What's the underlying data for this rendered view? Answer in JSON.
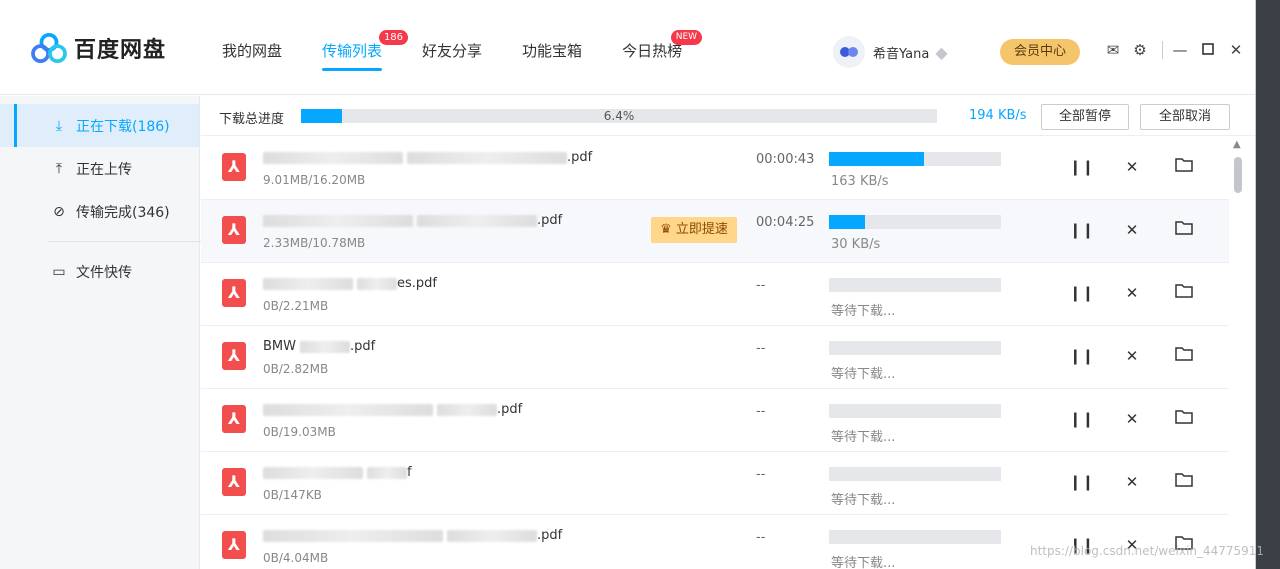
{
  "app": {
    "name": "百度网盘"
  },
  "nav": {
    "tabs": [
      {
        "label": "我的网盘"
      },
      {
        "label": "传输列表",
        "badge": "186"
      },
      {
        "label": "好友分享"
      },
      {
        "label": "功能宝箱"
      },
      {
        "label": "今日热榜",
        "badge": "NEW"
      }
    ]
  },
  "user": {
    "name": "希音Yana",
    "vip_label": "会员中心"
  },
  "sidebar": {
    "items": [
      {
        "label": "正在下载(186)",
        "icon": "download-icon"
      },
      {
        "label": "正在上传",
        "icon": "upload-icon"
      },
      {
        "label": "传输完成(346)",
        "icon": "check-circle-icon"
      },
      {
        "label": "文件快传",
        "icon": "monitor-icon"
      }
    ]
  },
  "progress": {
    "label": "下载总进度",
    "percent_text": "6.4%",
    "percent": 6.4,
    "speed": "194 KB/s",
    "pause_all": "全部暂停",
    "cancel_all": "全部取消"
  },
  "downloads": [
    {
      "name_a": "",
      "name_b": ".pdf",
      "size": "9.01MB/16.20MB",
      "time": "00:00:43",
      "progress": 0.55,
      "speed": "163 KB/s"
    },
    {
      "name_a": "",
      "name_b": ".pdf",
      "size": "2.33MB/10.78MB",
      "time": "00:04:25",
      "progress": 0.21,
      "speed": "30 KB/s",
      "boost": "立即提速"
    },
    {
      "name_a": "",
      "name_b": "es.pdf",
      "size": "0B/2.21MB",
      "time": "--",
      "progress": 0,
      "speed": "等待下载..."
    },
    {
      "name_a": "BMW",
      "name_b": ".pdf",
      "size": "0B/2.82MB",
      "time": "--",
      "progress": 0,
      "speed": "等待下载..."
    },
    {
      "name_a": "",
      "name_b": ".pdf",
      "size": "0B/19.03MB",
      "time": "--",
      "progress": 0,
      "speed": "等待下载..."
    },
    {
      "name_a": "",
      "name_b": "f",
      "size": "0B/147KB",
      "time": "--",
      "progress": 0,
      "speed": "等待下载..."
    },
    {
      "name_a": "",
      "name_b": ".pdf",
      "size": "0B/4.04MB",
      "time": "--",
      "progress": 0,
      "speed": "等待下载..."
    }
  ],
  "watermark": "https://blog.csdn.net/weixin_44775911"
}
